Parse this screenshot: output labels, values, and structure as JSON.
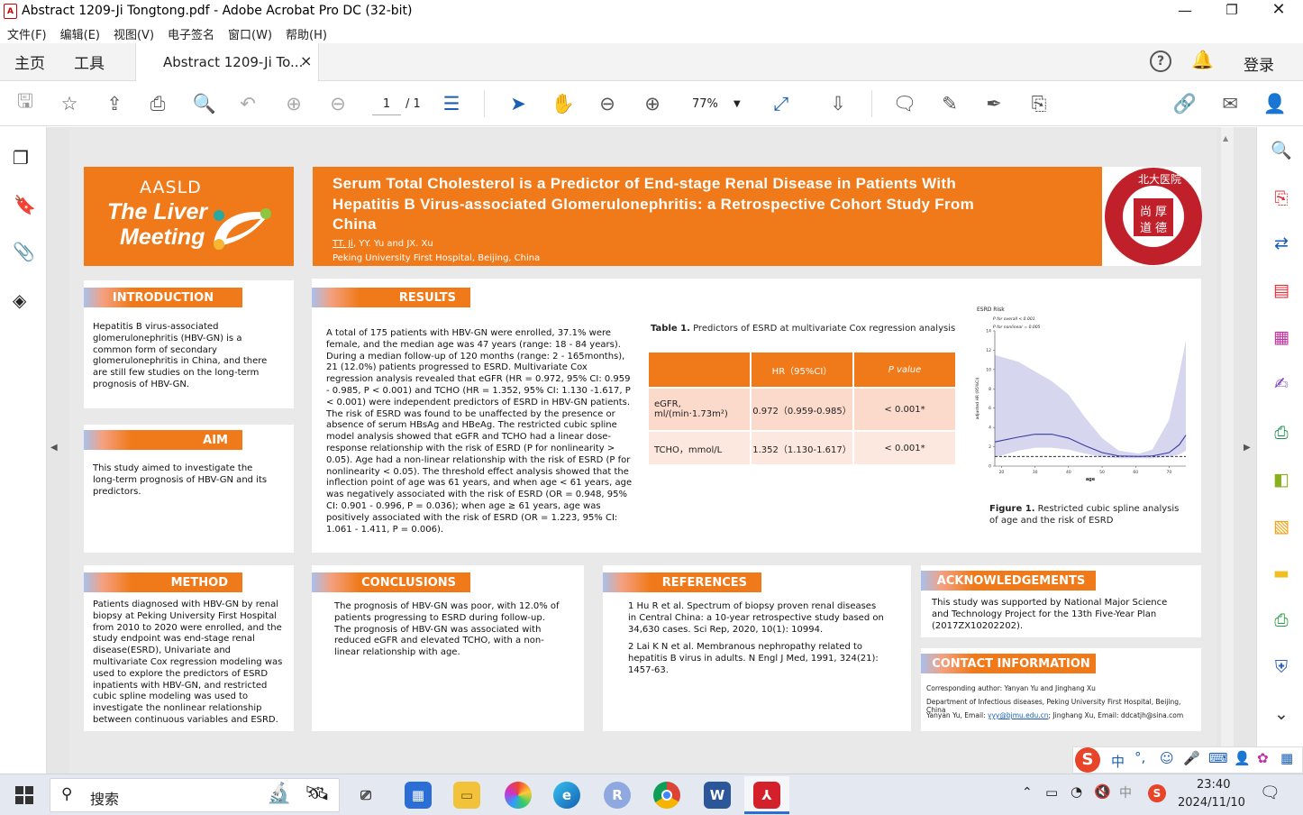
{
  "window": {
    "title": "Abstract 1209-Ji Tongtong.pdf - Adobe Acrobat Pro DC (32-bit)"
  },
  "menu": [
    "文件(F)",
    "编辑(E)",
    "视图(V)",
    "电子签名",
    "窗口(W)",
    "帮助(H)"
  ],
  "tabs": {
    "home": "主页",
    "tools": "工具",
    "doc": "Abstract 1209-Ji To...",
    "close": "×",
    "login": "登录"
  },
  "toolbar": {
    "page_current": "1",
    "page_total": "/ 1",
    "zoom": "77%"
  },
  "poster": {
    "aasld": "AASLD",
    "meeting_line1": "The Liver",
    "meeting_line2": "Meeting",
    "title": "Serum Total Cholesterol is a Predictor of End-stage Renal Disease in Patients With Hepatitis B Virus-associated Glomerulonephritis: a Retrospective Cohort Study From China",
    "authors_first": "TT. Ji",
    "authors_rest": ", YY. Yu and JX. Xu",
    "affiliation": "Peking University First Hospital, Beijing, China",
    "seal_text": "北大医院",
    "intro_head": "INTRODUCTION",
    "intro_text": "Hepatitis B virus-associated glomerulonephritis (HBV-GN) is a common form of secondary glomerulonephritis in China, and there are still few studies on the long-term prognosis of HBV-GN.",
    "aim_head": "AIM",
    "aim_text": "This study aimed to investigate the long-term prognosis of HBV-GN and its predictors.",
    "results_head": "RESULTS",
    "results_text": "A total of 175 patients with HBV-GN were enrolled, 37.1% were female, and the median age was 47 years (range: 18 - 84 years). During a median follow-up of 120 months (range: 2 - 165months), 21 (12.0%) patients progressed to ESRD. Multivariate Cox regression analysis revealed that eGFR (HR = 0.972, 95% CI: 0.959 - 0.985, P < 0.001) and TCHO (HR = 1.352, 95% CI: 1.130 -1.617, P < 0.001) were independent predictors of ESRD in HBV-GN patients. The risk of ESRD was found to be unaffected by the presence or absence of serum HBsAg and HBeAg. The restricted cubic spline model analysis showed that eGFR and TCHO had a linear dose-response relationship with the risk of ESRD (P for nonlinearity > 0.05). Age had a non-linear relationship with the risk of ESRD (P for nonlinearity < 0.05). The threshold effect analysis showed that the inflection point of age was 61 years, and when age < 61 years, age was negatively associated with the risk of ESRD (OR = 0.948, 95% CI: 0.901 - 0.996, P = 0.036); when age ≥ 61 years, age was positively associated with the risk of ESRD (OR = 1.223, 95% CI: 1.061 - 1.411, P = 0.006).",
    "table_caption_bold": "Table 1.",
    "table_caption": " Predictors of ESRD at multivariate Cox regression analysis",
    "table": {
      "headers": [
        "",
        "HR（95%CI）",
        "P value"
      ],
      "rows": [
        [
          "eGFR, ml/(min·1.73m²)",
          "0.972（0.959-0.985）",
          "< 0.001*"
        ],
        [
          "TCHO，mmol/L",
          "1.352（1.130-1.617）",
          "< 0.001*"
        ]
      ]
    },
    "fig_caption_bold": "Figure 1.",
    "fig_caption": " Restricted cubic spline analysis of age and the risk of ESRD",
    "method_head": "METHOD",
    "method_text": "Patients diagnosed with HBV-GN by renal biopsy at Peking University First Hospital from 2010 to 2020 were enrolled, and the study endpoint was end-stage renal disease(ESRD), Univariate and multivariate Cox regression modeling was used to explore the predictors of ESRD inpatients with HBV-GN, and restricted cubic spline modeling was used to investigate the nonlinear relationship between continuous variables and ESRD.",
    "conclusions_head": "CONCLUSIONS",
    "conclusions_text": "The prognosis of HBV-GN was poor, with 12.0% of patients progressing to ESRD during follow-up. The prognosis of HBV-GN was associated with reduced eGFR and elevated TCHO, with a non-linear relationship with age.",
    "references_head": "REFERENCES",
    "ref1": "1 Hu R et al. Spectrum of biopsy proven renal diseases in Central China: a 10-year retrospective study based on 34,630 cases. Sci Rep, 2020, 10(1): 10994.",
    "ref2": "2 Lai K N et al. Membranous nephropathy related to hepatitis B virus in adults. N Engl J Med, 1991, 324(21): 1457-63.",
    "ack_head": "ACKNOWLEDGEMENTS",
    "ack_text": "This study was supported by National Major Science and Technology Project for the 13th Five-Year Plan (2017ZX10202202).",
    "contact_head": "CONTACT INFORMATION",
    "contact_line1": "Corresponding author: Yanyan Yu and Jinghang Xu",
    "contact_line2": "Department of Infectious diseases, Peking University First Hospital, Beijing, China",
    "contact_line3a": "Yanyan Yu, Email: ",
    "contact_email1": "yyy@bjmu.edu.cn",
    "contact_line3b": "; Jinghang Xu, Email: ddcatjh@sina.com"
  },
  "chart_data": {
    "type": "line",
    "title": "ESRD Risk",
    "legend": [
      "P for overall < 0.001",
      "P for nonlinear = 0.005"
    ],
    "xlabel": "age",
    "ylabel": "adjusted HR (95%CI)",
    "xlim": [
      18,
      75
    ],
    "ylim": [
      0,
      14
    ],
    "x_ticks": [
      20,
      30,
      40,
      50,
      60,
      70
    ],
    "y_ticks": [
      0,
      2,
      4,
      6,
      8,
      10,
      12,
      14
    ],
    "reference_line": 1,
    "x": [
      18,
      25,
      30,
      35,
      40,
      45,
      50,
      55,
      61,
      65,
      70,
      73,
      75
    ],
    "y": [
      2.5,
      3,
      3.3,
      3.3,
      2.9,
      2.1,
      1.4,
      1.05,
      1.0,
      1.05,
      1.4,
      2.2,
      3.2
    ],
    "ci_lower": [
      0.9,
      1.6,
      1.9,
      1.9,
      1.7,
      1.3,
      0.95,
      0.8,
      0.8,
      0.8,
      0.95,
      1.2,
      1.6
    ],
    "ci_upper": [
      11.5,
      10.8,
      9.8,
      8.8,
      7.4,
      5.0,
      2.9,
      1.6,
      1.3,
      1.7,
      4.8,
      9.5,
      13.0
    ]
  },
  "taskbar": {
    "search": "搜索",
    "time": "23:40",
    "date": "2024/11/10",
    "ime": "中"
  }
}
